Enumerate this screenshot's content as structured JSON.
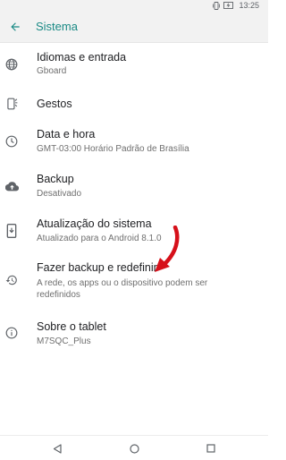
{
  "status_bar": {
    "time": "13:25",
    "icons": [
      "vibrate-icon",
      "battery-charging-icon"
    ]
  },
  "app_bar": {
    "title": "Sistema",
    "back_icon": "arrow-back-icon"
  },
  "settings": [
    {
      "icon": "globe-icon",
      "title": "Idiomas e entrada",
      "subtitle": "Gboard"
    },
    {
      "icon": "gestures-icon",
      "title": "Gestos",
      "subtitle": ""
    },
    {
      "icon": "clock-icon",
      "title": "Data e hora",
      "subtitle": "GMT-03:00 Horário Padrão de Brasília"
    },
    {
      "icon": "cloud-upload-icon",
      "title": "Backup",
      "subtitle": "Desativado"
    },
    {
      "icon": "system-update-icon",
      "title": "Atualização do sistema",
      "subtitle": "Atualizado para o Android 8.1.0"
    },
    {
      "icon": "restore-icon",
      "title": "Fazer backup e redefinir",
      "subtitle": "A rede, os apps ou o dispositivo podem ser redefinidos"
    },
    {
      "icon": "info-icon",
      "title": "Sobre o tablet",
      "subtitle": "M7SQC_Plus"
    }
  ],
  "nav_bar": {
    "back": "nav-back-icon",
    "home": "nav-home-icon",
    "recents": "nav-recents-icon"
  },
  "colors": {
    "accent": "#1a8a85",
    "annotation_arrow": "#d6101a",
    "icon": "#5f6368"
  }
}
